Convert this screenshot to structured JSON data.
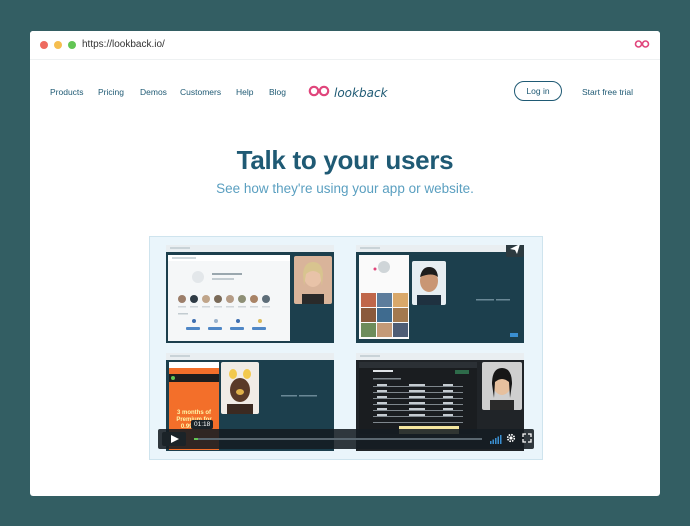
{
  "browser": {
    "url": "https://lookback.io/"
  },
  "nav": {
    "links": [
      "Products",
      "Pricing",
      "Demos",
      "Customers",
      "Help",
      "Blog"
    ],
    "brand": "lookback",
    "login": "Log in",
    "trial": "Start free trial"
  },
  "hero": {
    "title": "Talk to your users",
    "subtitle": "See how they're using your app or website."
  },
  "video": {
    "timecode": "01:18",
    "progress_fraction": 0.014,
    "promo": {
      "line1": "3 months of",
      "line2": "Premium for",
      "line3": "0.99 CAD"
    }
  },
  "colors": {
    "background": "#335e63",
    "brand": "#1f5a74",
    "accent": "#5a9fc0",
    "logo": "#e0457b"
  }
}
